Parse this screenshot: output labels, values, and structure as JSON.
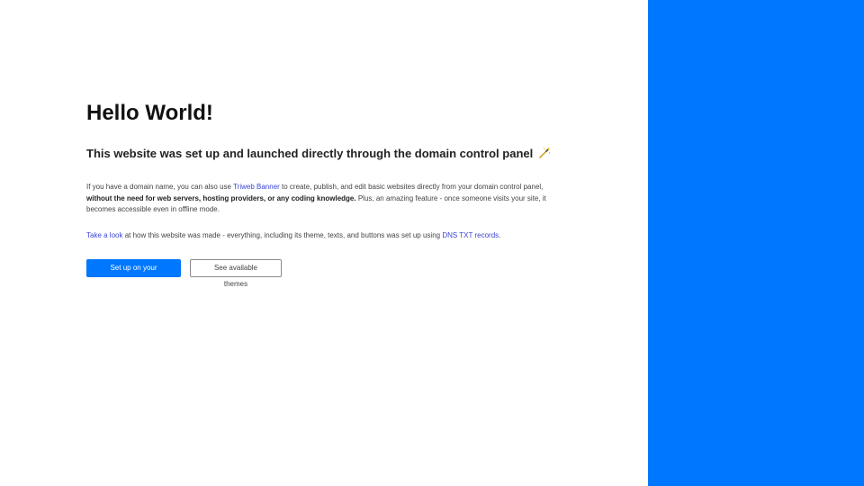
{
  "colors": {
    "accent": "#0077FF",
    "link": "#3b45d6"
  },
  "hero": {
    "title": "Hello World!",
    "subtitle": "This website was set up and launched directly through the domain control panel",
    "subtitle_icon": "magic-wand-icon"
  },
  "intro": {
    "text_before_link": "If you have a domain name, you can also use ",
    "link_label": "Triweb Banner",
    "text_after_link": " to create, publish, and edit basic websites directly from your domain control panel, ",
    "bold_text": "without the need for web servers, hosting providers, or any coding knowledge.",
    "text_end": " Plus, an amazing feature - once someone visits your site, it becomes accessible even in offline mode."
  },
  "details": {
    "link_label": "Take a look",
    "middle_text": " at how this website was made - everything, including its theme, texts, and buttons was set up using ",
    "dns_link_label": "DNS TXT records",
    "end_text": "."
  },
  "actions": {
    "primary_label": "Set up on your domain",
    "secondary_label": "See available themes"
  }
}
